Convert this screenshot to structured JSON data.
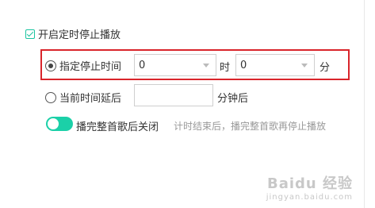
{
  "header": {
    "enable_label": "开启定时停止播放",
    "enabled": true
  },
  "specified_time": {
    "label": "指定停止时间",
    "selected": true,
    "hour_value": "0",
    "hour_unit": "时",
    "minute_value": "0",
    "minute_unit": "分"
  },
  "delay": {
    "label": "当前时间延后",
    "selected": false,
    "value": "",
    "unit": "分钟后"
  },
  "finish_song": {
    "toggle_on": true,
    "label": "播完整首歌后关闭",
    "hint": "计时结束后，播完整首歌再停止播放"
  },
  "watermark": {
    "main": "Baidu 经验",
    "sub": "jingyan.baidu.com"
  },
  "colors": {
    "accent": "#1bd0a8",
    "highlight_border": "#d9252b"
  }
}
